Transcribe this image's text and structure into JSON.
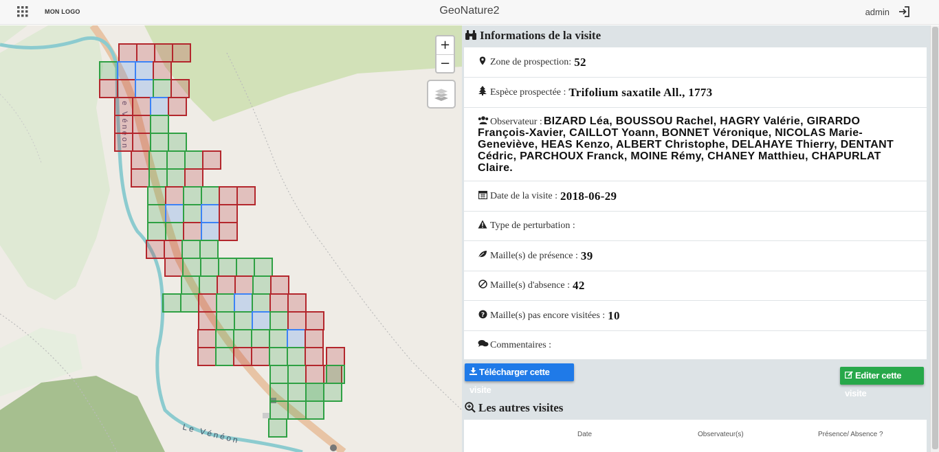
{
  "header": {
    "logo": "MON LOGO",
    "title": "GeoNature2",
    "user": "admin"
  },
  "map": {
    "zoom_in": "+",
    "zoom_out": "−",
    "labels": {
      "river": "Le Vénéon",
      "river_vertical": "e Vénéon"
    },
    "colors": {
      "presence": "#2ea043",
      "absence": "#b3262c",
      "not_visited": "#3b82f6",
      "road": "#e8b591",
      "river": "#86c8cc",
      "forest": "#cfe3bc"
    }
  },
  "panel": {
    "visit_title": "Informations de la visite",
    "fields": {
      "zone_label": "Zone de prospection:",
      "zone_value": "52",
      "species_label": "Espèce prospectée :",
      "species_value": "Trifolium saxatile All., 1773",
      "observer_label": "Observateur :",
      "observer_value": "BIZARD Léa, BOUSSOU Rachel, HAGRY Valérie, GIRARDO François-Xavier, CAILLOT Yoann, BONNET Véronique, NICOLAS Marie-Geneviève, HEAS Kenzo, ALBERT Christophe, DELAHAYE Thierry, DENTANT Cédric, PARCHOUX Franck, MOINE Rémy, CHANEY Matthieu, CHAPURLAT Claire.",
      "date_label": "Date de la visite :",
      "date_value": "2018-06-29",
      "perturbation_label": "Type de perturbation :",
      "presence_label": "Maille(s) de présence :",
      "presence_value": "39",
      "absence_label": "Maille(s) d'absence :",
      "absence_value": "42",
      "notvisited_label": "Maille(s) pas encore visitées :",
      "notvisited_value": "10",
      "comments_label": "Commentaires :"
    },
    "download_button": "Télécharger cette visite",
    "edit_button": "Editer cette visite",
    "other_visits_title": "Les autres visites",
    "table_headers": [
      "Date",
      "Observateur(s)",
      "Présence/ Absence ?"
    ]
  }
}
